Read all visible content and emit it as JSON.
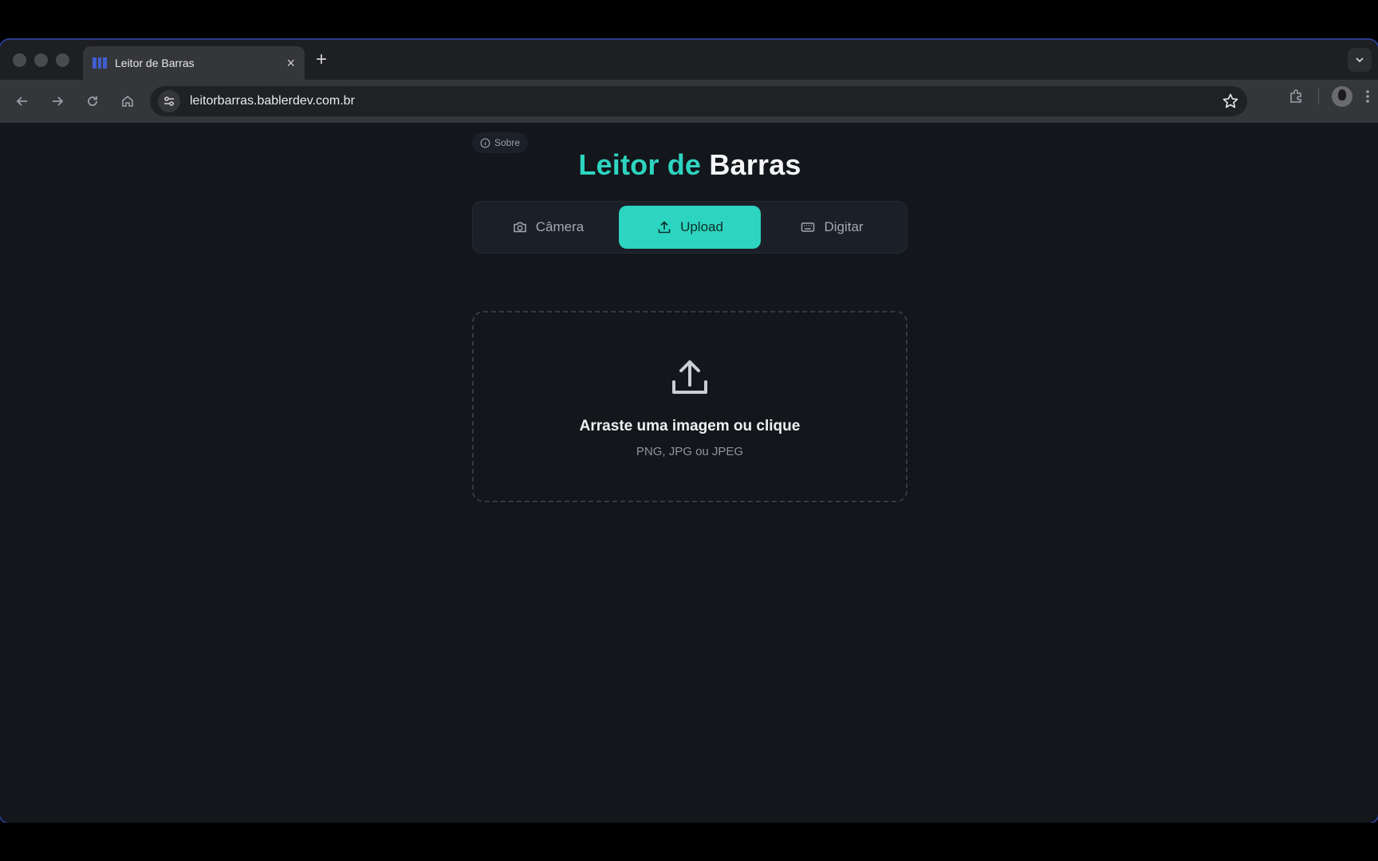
{
  "browser": {
    "tab_title": "Leitor de Barras",
    "tab_close_icon": "×",
    "new_tab_icon": "+",
    "url": "leitorbarras.bablerdev.com.br"
  },
  "page": {
    "about_label": "Sobre",
    "title_accent": "Leitor de",
    "title_plain": "Barras",
    "accent_color": "#2dd4bf",
    "tabs": [
      {
        "label": "Câmera",
        "icon": "camera-icon",
        "active": false
      },
      {
        "label": "Upload",
        "icon": "upload-icon",
        "active": true
      },
      {
        "label": "Digitar",
        "icon": "keyboard-icon",
        "active": false
      }
    ],
    "dropzone": {
      "title": "Arraste uma imagem ou clique",
      "subtitle": "PNG, JPG ou JPEG"
    }
  }
}
